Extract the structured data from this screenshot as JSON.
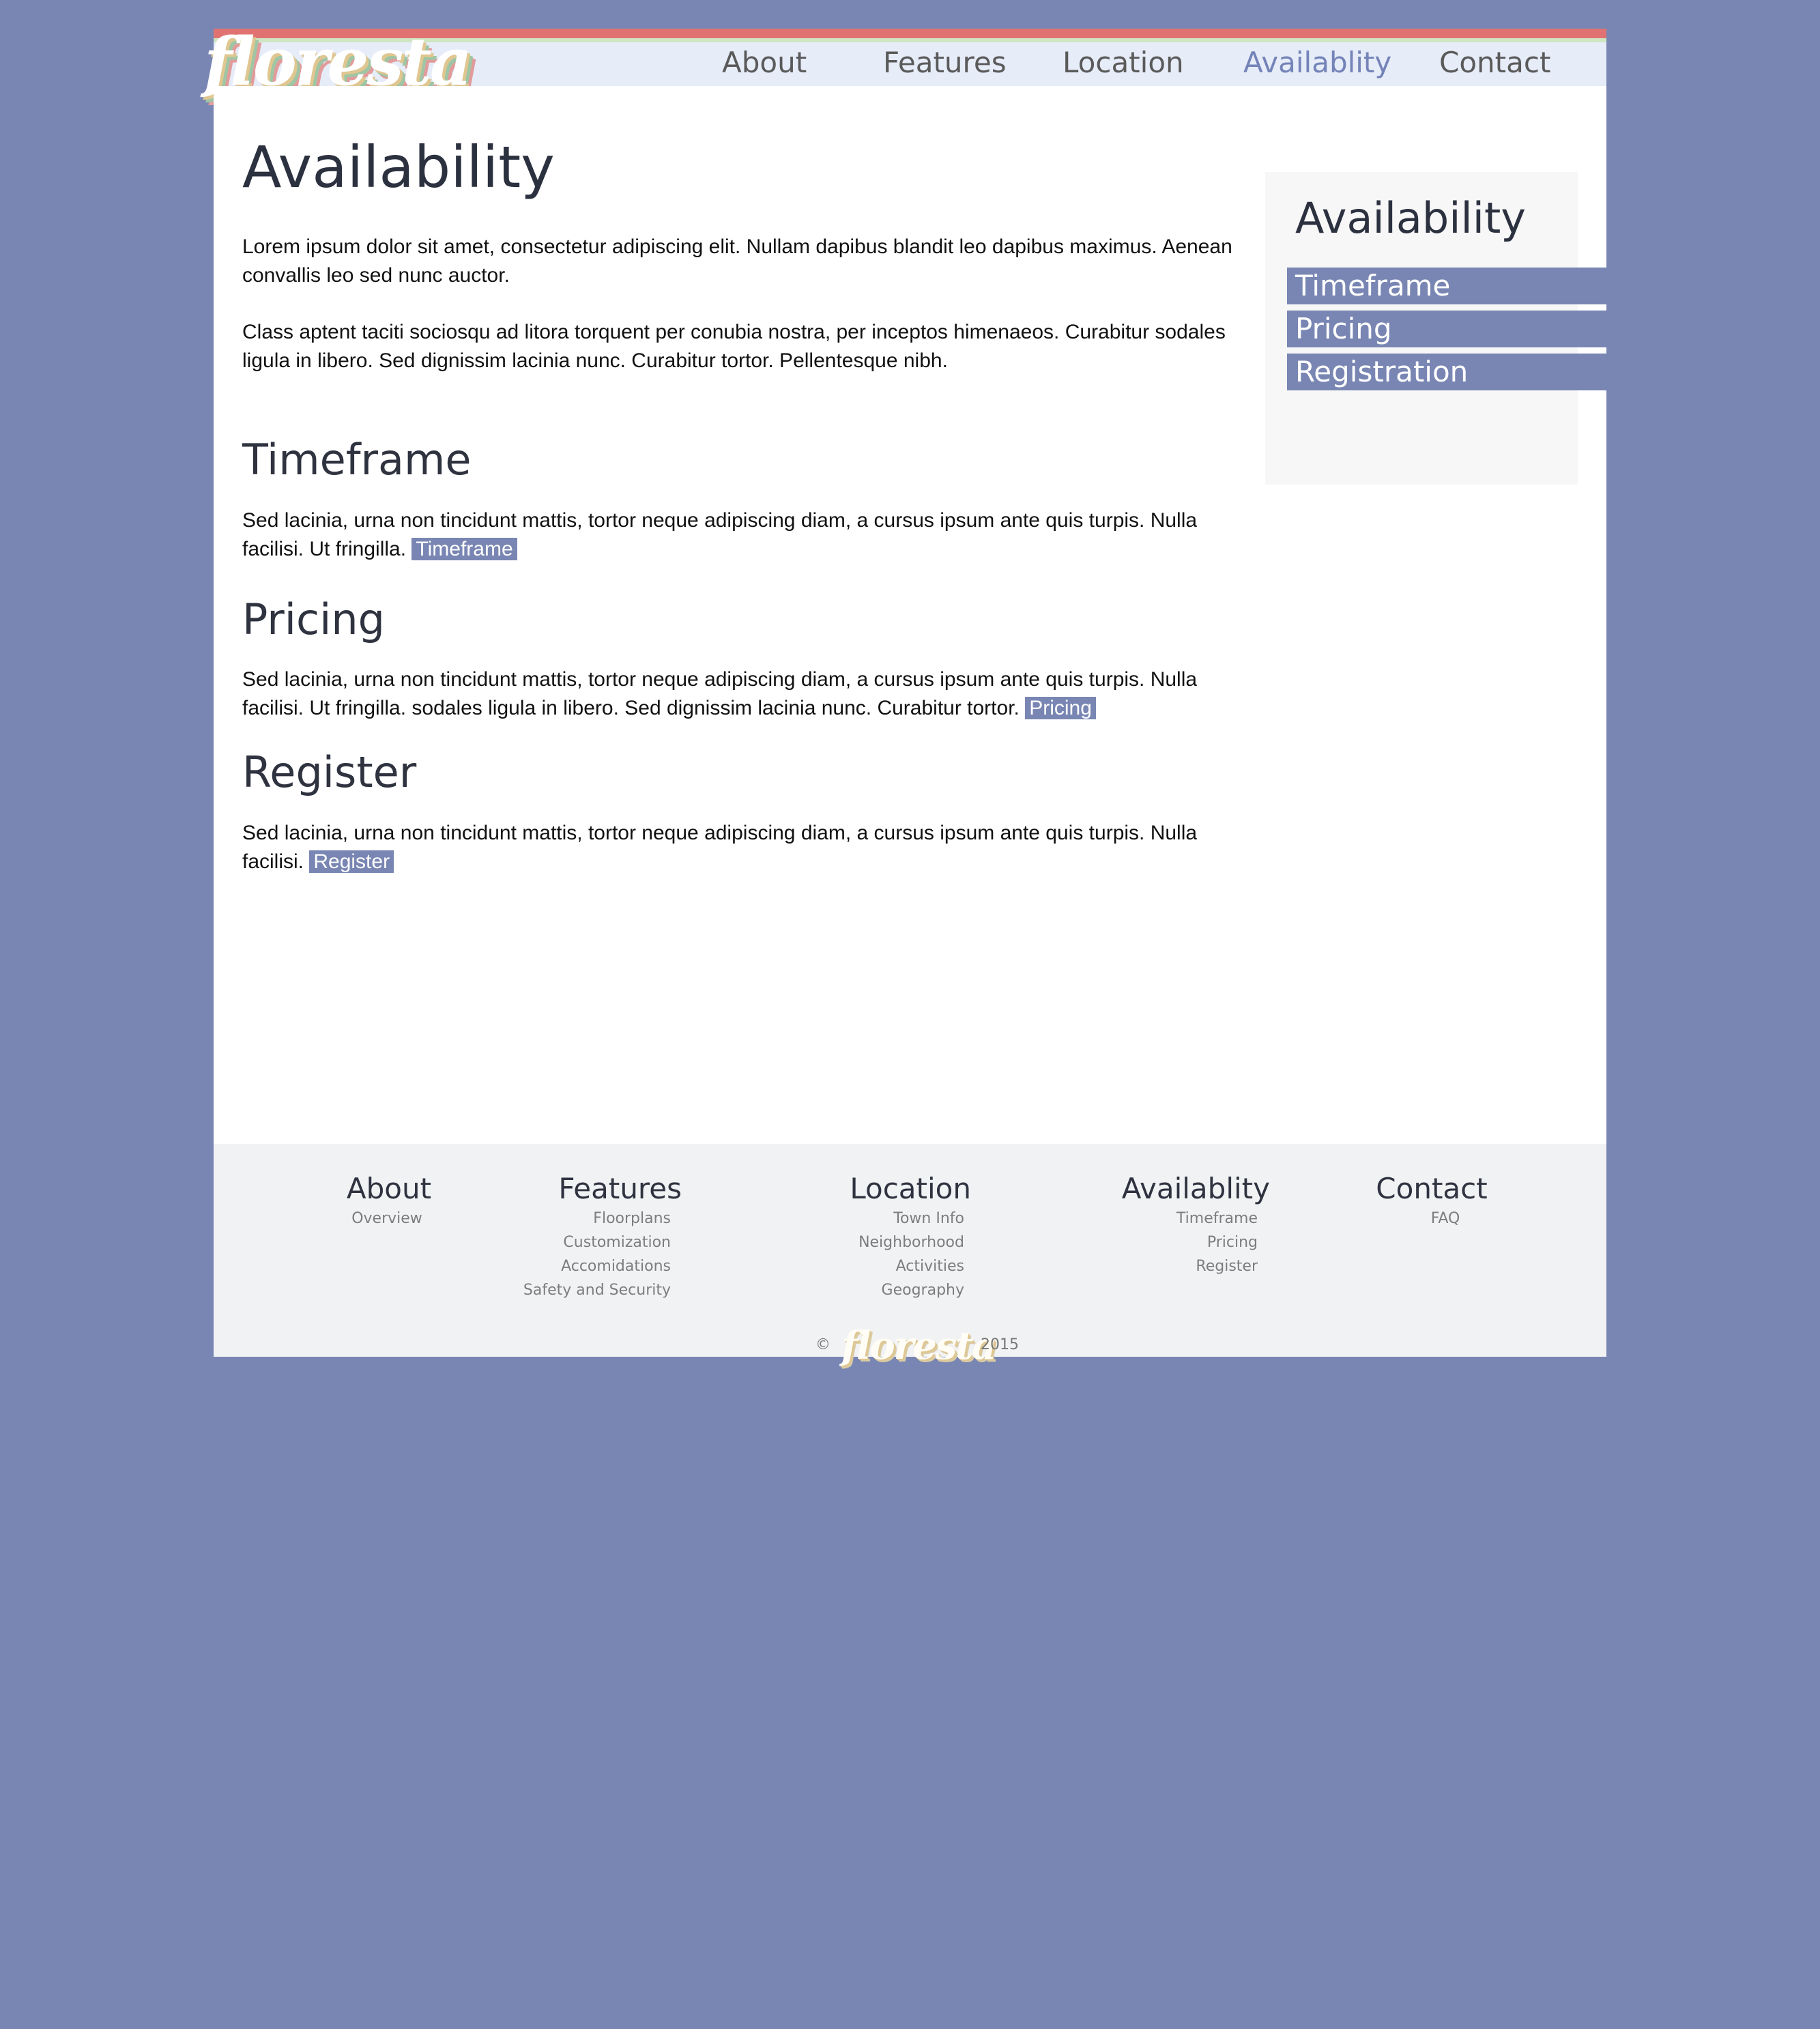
{
  "brand": {
    "logo_text": "floresta"
  },
  "nav": [
    {
      "label": "About"
    },
    {
      "label": "Features"
    },
    {
      "label": "Location"
    },
    {
      "label": "Availablity"
    },
    {
      "label": "Contact"
    }
  ],
  "main": {
    "title": "Availability",
    "intro_1": "Lorem ipsum dolor sit amet, consectetur adipiscing elit. Nullam dapibus blandit leo dapibus maximus. Aenean convallis leo sed nunc auctor.",
    "intro_2": "Class aptent taciti sociosqu ad litora torquent per conubia nostra, per inceptos himenaeos. Curabitur sodales ligula in libero. Sed dignissim lacinia nunc. Curabitur tortor. Pellentesque nibh.",
    "sections": [
      {
        "heading": "Timeframe",
        "text": "Sed lacinia, urna non tincidunt mattis, tortor neque adipiscing diam, a cursus ipsum ante quis turpis. Nulla facilisi. Ut fringilla.",
        "tag": "Timeframe"
      },
      {
        "heading": "Pricing",
        "text": "Sed lacinia, urna non tincidunt mattis, tortor neque adipiscing diam, a cursus ipsum ante quis turpis. Nulla facilisi. Ut fringilla.   sodales ligula in libero. Sed dignissim lacinia nunc. Curabitur tortor.",
        "tag": "Pricing"
      },
      {
        "heading": "Register",
        "text": "Sed lacinia, urna non tincidunt mattis, tortor neque adipiscing diam, a cursus ipsum ante quis turpis. Nulla facilisi.",
        "tag": "Register"
      }
    ]
  },
  "sidebar": {
    "title": "Availability",
    "items": [
      {
        "label": "Timeframe"
      },
      {
        "label": "Pricing"
      },
      {
        "label": "Registration"
      }
    ]
  },
  "footer": {
    "columns": [
      {
        "heading": "About",
        "links": [
          "Overview"
        ]
      },
      {
        "heading": "Features",
        "links": [
          "Floorplans",
          "Customization",
          "Accomidations",
          "Safety and Security"
        ]
      },
      {
        "heading": "Location",
        "links": [
          "Town Info",
          "Neighborhood",
          "Activities",
          "Geography"
        ]
      },
      {
        "heading": "Availablity",
        "links": [
          "Timeframe",
          "Pricing",
          "Register"
        ]
      },
      {
        "heading": "Contact",
        "links": [
          "FAQ"
        ]
      }
    ],
    "copyright_symbol": "©",
    "year": "2015"
  },
  "colors": {
    "background": "#7986b3",
    "accent": "#7986b3",
    "nav_active": "#7483b8",
    "header_bg": "#e6ecf8",
    "stripe_red": "#e07372",
    "stripe_green": "#cfe6c2"
  }
}
